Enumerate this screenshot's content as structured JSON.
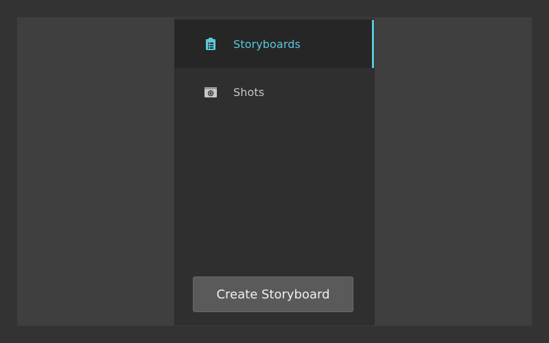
{
  "sidebar": {
    "items": [
      {
        "label": "Storyboards",
        "icon": "clipboard-icon",
        "active": true
      },
      {
        "label": "Shots",
        "icon": "camera-icon",
        "active": false
      }
    ],
    "create_label": "Create Storyboard"
  },
  "colors": {
    "accent": "#5bc8dc",
    "panel": "#2f2f2f",
    "active_row": "#262626",
    "button": "#5a5a5a"
  }
}
